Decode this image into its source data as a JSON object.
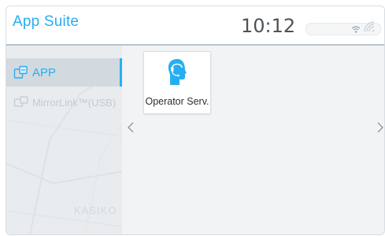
{
  "header": {
    "app_title": "App Suite",
    "clock": "10:12",
    "status_icons": [
      "wifi-icon",
      "signal-icon"
    ]
  },
  "sidebar": {
    "items": [
      {
        "label": "APP",
        "icon": "app-icon",
        "state": "selected"
      },
      {
        "label": "MirrorLink™(USB)",
        "icon": "mirrorlink-icon",
        "state": "disabled"
      }
    ],
    "background_map_text": "KASIKO"
  },
  "main": {
    "apps": [
      {
        "label": "Operator Serv.",
        "icon": "operator-headset-icon"
      }
    ],
    "nav": {
      "prev": "chevron-left-icon",
      "next": "chevron-right-icon"
    }
  },
  "colors": {
    "accent": "#27aef2",
    "text_dark": "#2b2f33",
    "disabled": "#c4cacf",
    "background": "#f1f3f5"
  }
}
